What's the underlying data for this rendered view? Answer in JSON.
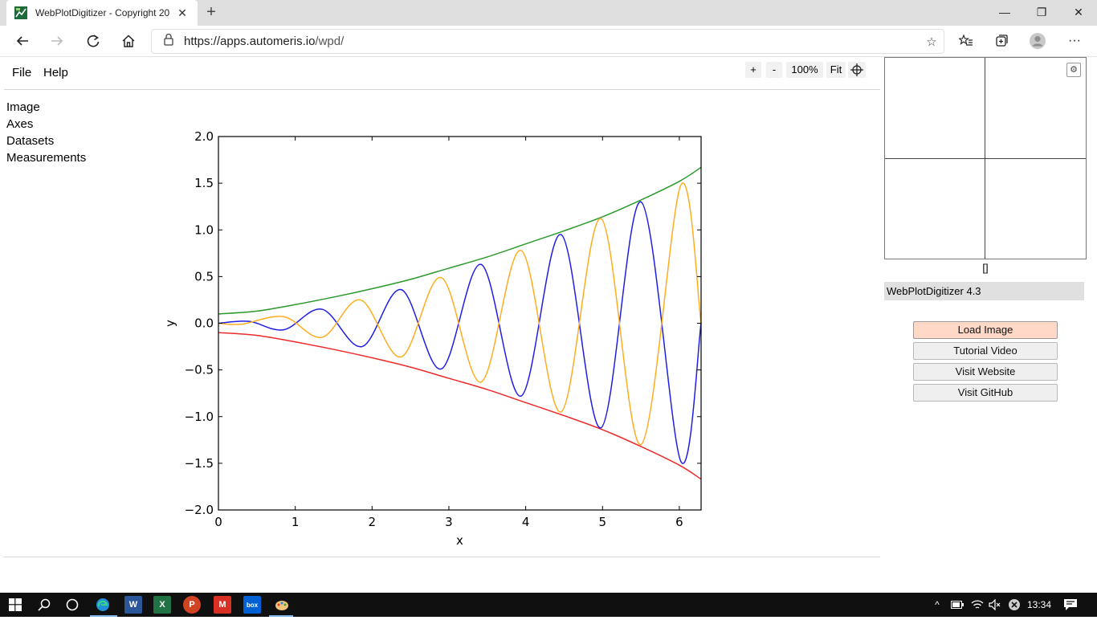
{
  "browser": {
    "tab_title": "WebPlotDigitizer - Copyright 20",
    "tab_close": "✕",
    "new_tab": "+",
    "url_host": "https://apps.automeris.io",
    "url_path": "/wpd/",
    "window_min": "—",
    "window_restore": "❐",
    "window_close": "✕",
    "more": "···"
  },
  "app": {
    "menu": {
      "file": "File",
      "help": "Help"
    },
    "zoom": {
      "in": "+",
      "out": "-",
      "level": "100%",
      "fit": "Fit"
    },
    "sidebar": [
      "Image",
      "Axes",
      "Datasets",
      "Measurements"
    ],
    "panel": {
      "coords": "[]",
      "version": "WebPlotDigitizer 4.3",
      "buttons": [
        "Load Image",
        "Tutorial Video",
        "Visit Website",
        "Visit GitHub"
      ],
      "loupe_settings": "⚙"
    }
  },
  "taskbar": {
    "time": "13:34",
    "apps": [
      "W",
      "X",
      "P",
      "M",
      "box"
    ]
  },
  "colors": {
    "primary_button": "#ffd8c8",
    "series_blue": "#1f1fe6",
    "series_orange": "#ffad1f",
    "series_green": "#2c9a2c",
    "series_red": "#ee2a2a"
  },
  "chart_data": {
    "type": "line",
    "xlabel": "x",
    "ylabel": "y",
    "xlim": [
      0,
      6.2832
    ],
    "ylim": [
      -2.0,
      2.0
    ],
    "xticks": [
      "0",
      "1",
      "2",
      "3",
      "4",
      "5",
      "6"
    ],
    "yticks": [
      "2.0",
      "1.5",
      "1.0",
      "0.5",
      "0.0",
      "−0.5",
      "−1.0",
      "−1.5",
      "−2.0"
    ],
    "series": [
      {
        "color": "#2c9a2c",
        "x": [
          0,
          0.5,
          1.0,
          1.5,
          2.0,
          2.5,
          3.0,
          3.5,
          4.0,
          4.5,
          5.0,
          5.5,
          6.0,
          6.2832
        ],
        "y": [
          0.1,
          0.13,
          0.2,
          0.28,
          0.37,
          0.47,
          0.59,
          0.71,
          0.85,
          0.99,
          1.14,
          1.32,
          1.52,
          1.67
        ]
      },
      {
        "color": "#ee2a2a",
        "x": [
          0,
          0.5,
          1.0,
          1.5,
          2.0,
          2.5,
          3.0,
          3.5,
          4.0,
          4.5,
          5.0,
          5.5,
          6.0,
          6.2832
        ],
        "y": [
          -0.1,
          -0.13,
          -0.2,
          -0.28,
          -0.37,
          -0.47,
          -0.59,
          -0.71,
          -0.85,
          -0.99,
          -1.14,
          -1.32,
          -1.52,
          -1.67
        ]
      },
      {
        "color": "#1f1fe6",
        "x": [
          0,
          0.4,
          0.85,
          1.35,
          1.87,
          2.38,
          2.9,
          3.42,
          3.94,
          4.46,
          4.98,
          5.5,
          6.02,
          6.2832
        ],
        "y": [
          0.0,
          0.02,
          -0.07,
          0.15,
          -0.25,
          0.36,
          -0.49,
          0.63,
          -0.78,
          0.95,
          -1.12,
          1.3,
          -1.48,
          0.0
        ]
      },
      {
        "color": "#ffad1f",
        "x": [
          0,
          0.3,
          0.85,
          1.35,
          1.85,
          2.38,
          2.9,
          3.42,
          3.94,
          4.46,
          4.98,
          5.5,
          6.02,
          6.2832
        ],
        "y": [
          0.0,
          -0.01,
          0.07,
          -0.15,
          0.25,
          -0.36,
          0.49,
          -0.63,
          0.78,
          -0.95,
          1.12,
          -1.3,
          1.48,
          0.0
        ]
      }
    ]
  }
}
